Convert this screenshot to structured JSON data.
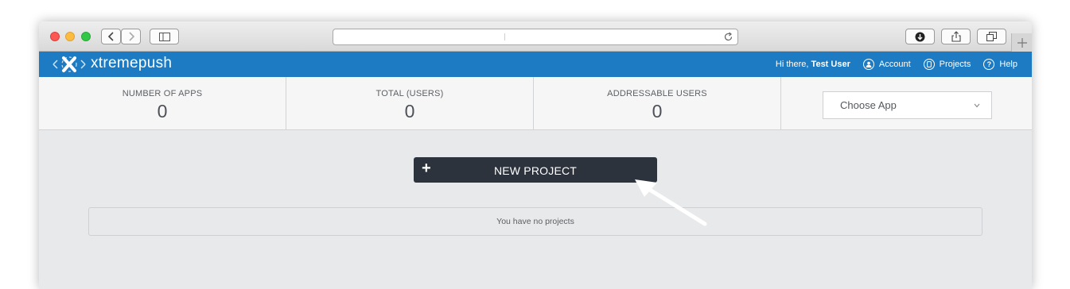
{
  "browser": {
    "traffic_lights": [
      "#fc5753",
      "#fdbc40",
      "#33c748"
    ],
    "icons": [
      "back-icon",
      "forward-icon",
      "sidebar-icon",
      "reload-icon",
      "download-icon",
      "share-icon",
      "tabs-icon",
      "plus-icon"
    ]
  },
  "navbar": {
    "brand": "xtremepush",
    "greeting": "Hi there, ",
    "user_name": "Test User",
    "account_label": "Account",
    "projects_label": "Projects",
    "help_label": "Help",
    "background": "#1c7bc3"
  },
  "stats": [
    {
      "label": "NUMBER OF APPS",
      "value": "0"
    },
    {
      "label": "TOTAL (USERS)",
      "value": "0"
    },
    {
      "label": "ADDRESSABLE USERS",
      "value": "0"
    }
  ],
  "app_select": {
    "placeholder": "Choose App"
  },
  "main": {
    "new_project_label": "NEW PROJECT",
    "empty_message": "You have no projects"
  }
}
